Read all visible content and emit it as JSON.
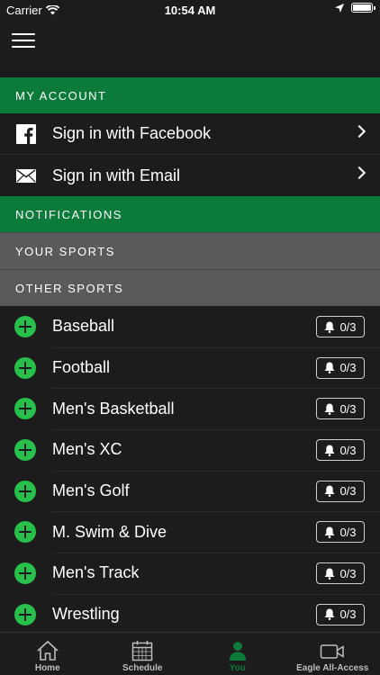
{
  "status": {
    "carrier": "Carrier",
    "time": "10:54 AM"
  },
  "sections": {
    "my_account": "MY ACCOUNT",
    "notifications": "NOTIFICATIONS",
    "your_sports": "YOUR SPORTS",
    "other_sports": "OTHER SPORTS"
  },
  "account": {
    "facebook": "Sign in with Facebook",
    "email": "Sign in with Email"
  },
  "sports": [
    {
      "name": "Baseball",
      "count": "0/3"
    },
    {
      "name": "Football",
      "count": "0/3"
    },
    {
      "name": "Men's Basketball",
      "count": "0/3"
    },
    {
      "name": "Men's XC",
      "count": "0/3"
    },
    {
      "name": "Men's Golf",
      "count": "0/3"
    },
    {
      "name": "M. Swim & Dive",
      "count": "0/3"
    },
    {
      "name": "Men's Track",
      "count": "0/3"
    },
    {
      "name": "Wrestling",
      "count": "0/3"
    }
  ],
  "tabs": [
    {
      "label": "Home",
      "icon": "home-icon"
    },
    {
      "label": "Schedule",
      "icon": "calendar-icon"
    },
    {
      "label": "You",
      "icon": "person-icon",
      "active": true
    },
    {
      "label": "Eagle All-Access",
      "icon": "video-icon"
    }
  ],
  "colors": {
    "accent": "#0c7a3a",
    "plus": "#27c04a",
    "section_gray": "#5a5a5a",
    "background": "#1c1c1c"
  }
}
